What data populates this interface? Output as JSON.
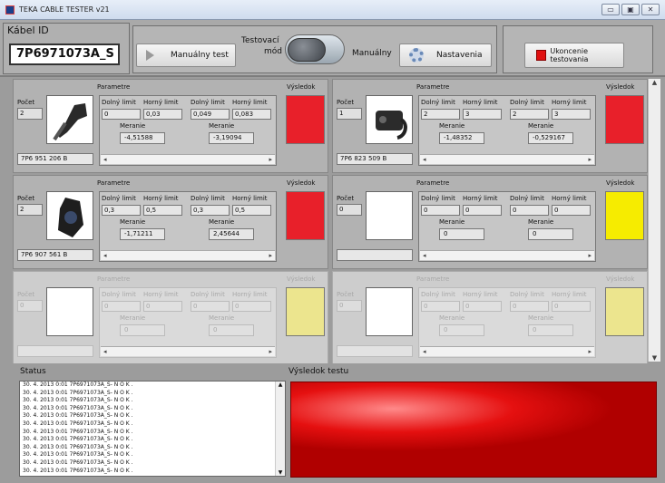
{
  "window": {
    "title": "TEKA CABLE TESTER v21",
    "buttons": [
      "▭",
      "▣",
      "✕"
    ]
  },
  "toolbar": {
    "kabel_label": "Kábel ID",
    "kabel_value": "7P6971073A_S",
    "manual_test_label": "Manuálny test",
    "mode_label_line1": "Testovací",
    "mode_label_line2": "mód",
    "manual_label": "Manuálny",
    "settings_label": "Nastavenia",
    "stop_label": "Ukoncenie testovania",
    "stop_color": "#e01010"
  },
  "labels": {
    "parametre": "Parametre",
    "vysledok": "Výsledok",
    "pocet": "Počet",
    "dolny": "Dolný limit",
    "horny": "Horný limit",
    "meranie": "Meranie"
  },
  "panels": [
    {
      "pocet": "2",
      "part": "7P6 951 206 B",
      "lim1": [
        "0",
        "0,03"
      ],
      "mer1": "-4,51588",
      "lim2": [
        "0,049",
        "0,083"
      ],
      "mer2": "-3,19094",
      "result_color": "#e8202a",
      "image": "cable-part-1"
    },
    {
      "pocet": "1",
      "part": "7P6 823 509 B",
      "lim1": [
        "2",
        "3"
      ],
      "mer1": "-1,48352",
      "lim2": [
        "2",
        "3"
      ],
      "mer2": "-0,529167",
      "result_color": "#e8202a",
      "image": "cable-part-2"
    },
    {
      "pocet": "2",
      "part": "7P6 907 561 B",
      "lim1": [
        "0,3",
        "0,5"
      ],
      "mer1": "-1,71211",
      "lim2": [
        "0,3",
        "0,5"
      ],
      "mer2": "2,45644",
      "result_color": "#e8202a",
      "image": "cable-part-3"
    },
    {
      "pocet": "0",
      "part": "",
      "lim1": [
        "0",
        "0"
      ],
      "mer1": "0",
      "lim2": [
        "0",
        "0"
      ],
      "mer2": "0",
      "result_color": "#f6ec00",
      "image": "empty"
    },
    {
      "pocet": "0",
      "part": "",
      "lim1": [
        "0",
        "0"
      ],
      "mer1": "0",
      "lim2": [
        "0",
        "0"
      ],
      "mer2": "0",
      "result_color": "#ece58e",
      "image": "empty"
    },
    {
      "pocet": "0",
      "part": "",
      "lim1": [
        "0",
        "0"
      ],
      "mer1": "0",
      "lim2": [
        "0",
        "0"
      ],
      "mer2": "0",
      "result_color": "#ece58e",
      "image": "empty"
    }
  ],
  "status": {
    "label": "Status",
    "lines": [
      "30. 4. 2013 0:01 7P6971073A_S- N O K .",
      "30. 4. 2013 0:01 7P6971073A_S- N O K .",
      "30. 4. 2013 0:01 7P6971073A_S- N O K .",
      "30. 4. 2013 0:01 7P6971073A_S- N O K .",
      "30. 4. 2013 0:01 7P6971073A_S- N O K .",
      "30. 4. 2013 0:01 7P6971073A_S- N O K .",
      "30. 4. 2013 0:01 7P6971073A_S- N O K .",
      "30. 4. 2013 0:01 7P6971073A_S- N O K .",
      "30. 4. 2013 0:01 7P6971073A_S- N O K .",
      "30. 4. 2013 0:01 7P6971073A_S- N O K .",
      "30. 4. 2013 0:01 7P6971073A_S- N O K .",
      "30. 4. 2013 0:01 7P6971073A_S- N O K ."
    ]
  },
  "result": {
    "label": "Výsledok testu",
    "color": "#e51010"
  }
}
